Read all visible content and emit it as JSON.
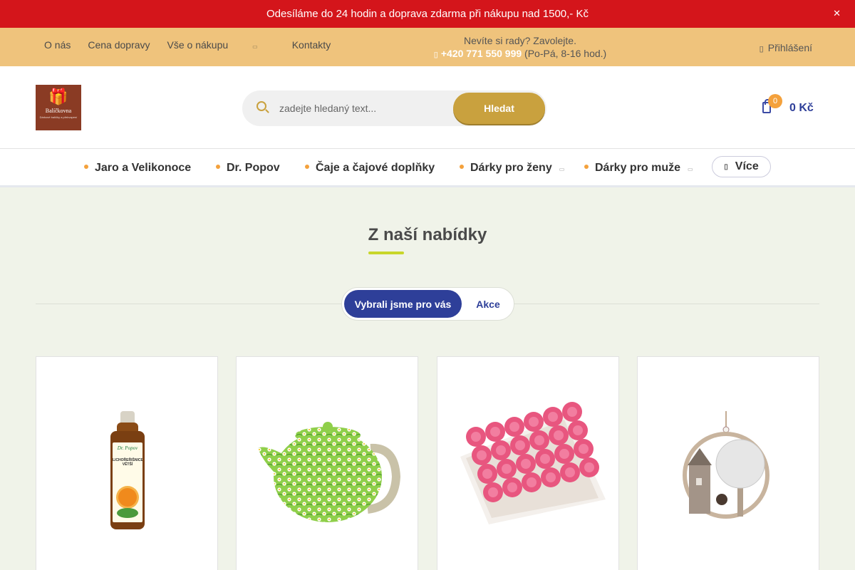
{
  "announcement": {
    "text": "Odesíláme do 24 hodin a doprava zdarma při nákupu nad 1500,- Kč",
    "close_icon": "close-icon"
  },
  "infobar": {
    "nav": [
      {
        "label": "O nás"
      },
      {
        "label": "Cena dopravy"
      },
      {
        "label": "Vše o nákupu",
        "has_dropdown": true
      },
      {
        "label": "Kontakty"
      }
    ],
    "contact_line1": "Nevíte si rady? Zavolejte.",
    "phone": "+420 771 550 999",
    "hours": "(Po-Pá, 8-16 hod.)",
    "login_label": "Přihlášení",
    "icons": [
      "phone-icon",
      "user-icon"
    ]
  },
  "header": {
    "logo_name": "Balíčkovna",
    "logo_tag": "Dárkové balíčky a překvapení",
    "search": {
      "placeholder": "zadejte hledaný text...",
      "button_label": "Hledat"
    },
    "cart": {
      "count": "0",
      "price": "0 Kč"
    }
  },
  "categories": [
    {
      "label": "Jaro a Velikonoce"
    },
    {
      "label": "Dr. Popov"
    },
    {
      "label": "Čaje a čajové doplňky"
    },
    {
      "label": "Dárky pro ženy",
      "has_dropdown": true
    },
    {
      "label": "Dárky pro muže",
      "has_dropdown": true
    }
  ],
  "more_label": "Více",
  "section": {
    "title": "Z naší nabídky",
    "tabs": [
      {
        "label": "Vybrali jsme pro vás",
        "active": true
      },
      {
        "label": "Akce",
        "active": false
      }
    ]
  },
  "products": [
    {
      "image": "herbal-drops-bottle",
      "brand": "Dr. Popov",
      "label": "LICHOŘEŘIŠNICE VĚTŠÍ"
    },
    {
      "image": "floral-teapot"
    },
    {
      "image": "pink-soap-roses-box"
    },
    {
      "image": "wooden-hanging-decoration"
    }
  ],
  "colors": {
    "announcement_bg": "#d4151b",
    "infobar_bg": "#efc37c",
    "accent_gold": "#c9a13e",
    "accent_blue": "#2e3f99",
    "accent_orange": "#f4a13c",
    "underline_green": "#c8d62a",
    "page_bg": "#f0f3e9"
  }
}
